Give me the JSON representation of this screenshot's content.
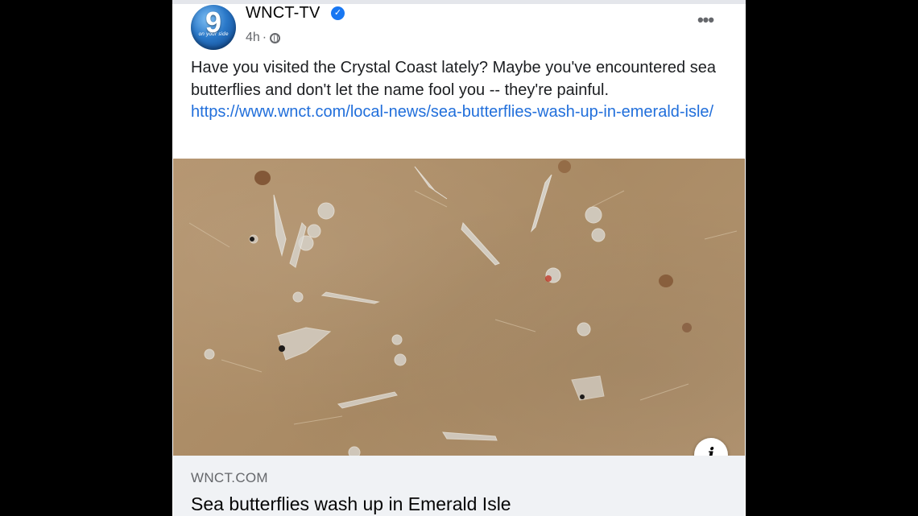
{
  "post": {
    "page_name": "WNCT-TV",
    "avatar_number": "9",
    "avatar_tagline": "on your side",
    "timestamp": "4h",
    "separator": "·",
    "audience_icon": "globe-icon",
    "more_icon": "more-options-icon",
    "more_label": "•••",
    "verified_icon": "verified-badge-icon",
    "verified_glyph": "✓",
    "text": "Have you visited the Crystal Coast lately? Maybe you've encountered sea butterflies and don't let the name fool you -- they're painful.",
    "link_url": "https://www.wnct.com/local-news/sea-butterflies-wash-up-in-emerald-isle/"
  },
  "link_preview": {
    "info_icon": "info-icon",
    "info_glyph": "i",
    "domain": "WNCT.COM",
    "title": "Sea butterflies wash up in Emerald Isle"
  },
  "colors": {
    "background": "#000000",
    "card": "#ffffff",
    "link": "#216fdb",
    "verified": "#1877f2",
    "secondary_text": "#65676b",
    "footer_bg": "#f0f2f5"
  }
}
